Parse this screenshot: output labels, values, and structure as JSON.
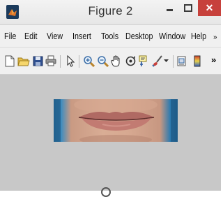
{
  "window": {
    "title": "Figure 2"
  },
  "menubar": {
    "items": [
      "File",
      "Edit",
      "View",
      "Insert",
      "Tools",
      "Desktop",
      "Window",
      "Help"
    ],
    "overflow": "»"
  },
  "toolbar": {
    "icons": [
      "new-figure-icon",
      "open-file-icon",
      "save-icon",
      "print-icon",
      "pointer-icon",
      "zoom-in-icon",
      "zoom-out-icon",
      "pan-icon",
      "rotate-3d-icon",
      "data-cursor-icon",
      "brush-icon",
      "dropdown-arrow-icon",
      "link-plot-icon",
      "colorbar-icon"
    ],
    "overflow": "»"
  },
  "colors": {
    "close_button": "#c7413c",
    "canvas_background": "#c8c8c8"
  }
}
